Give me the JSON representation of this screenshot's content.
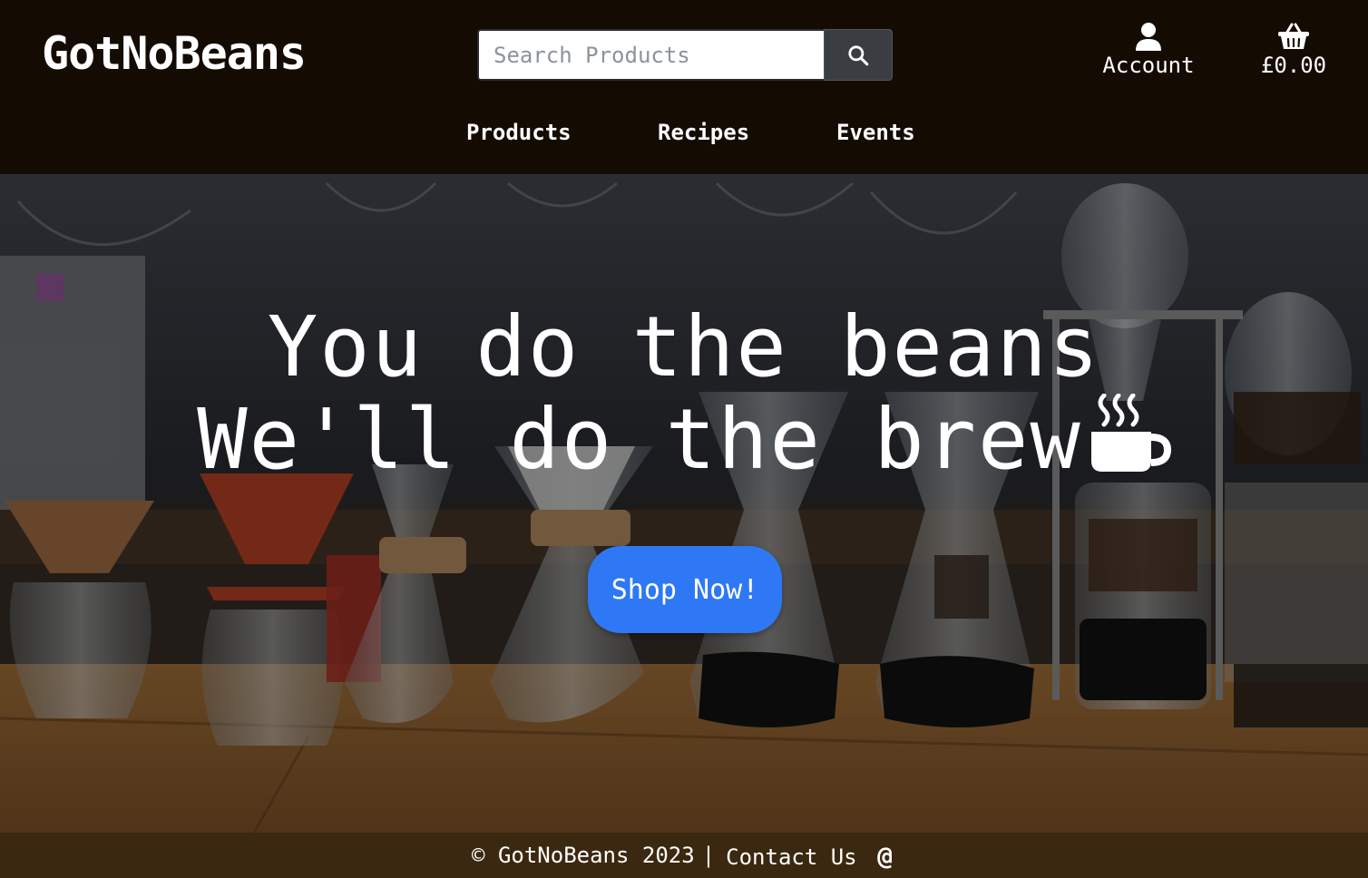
{
  "header": {
    "logo": "GotNoBeans",
    "search": {
      "placeholder": "Search Products",
      "value": ""
    },
    "account_label": "Account",
    "basket_total": "£0.00",
    "nav": [
      {
        "label": "Products"
      },
      {
        "label": "Recipes"
      },
      {
        "label": "Events"
      }
    ]
  },
  "hero": {
    "line1": "You do the beans",
    "line2": "We'll do the brew",
    "cta_label": "Shop Now!"
  },
  "footer": {
    "copyright": "© GotNoBeans 2023",
    "separator": "|",
    "contact_label": "Contact Us",
    "contact_symbol": "@"
  },
  "colors": {
    "header_bg": "#140b02",
    "footer_bg": "#3b2810",
    "cta": "#2e78f5"
  },
  "icons": [
    "search-icon",
    "account-icon",
    "basket-icon",
    "coffee-mug-icon"
  ]
}
